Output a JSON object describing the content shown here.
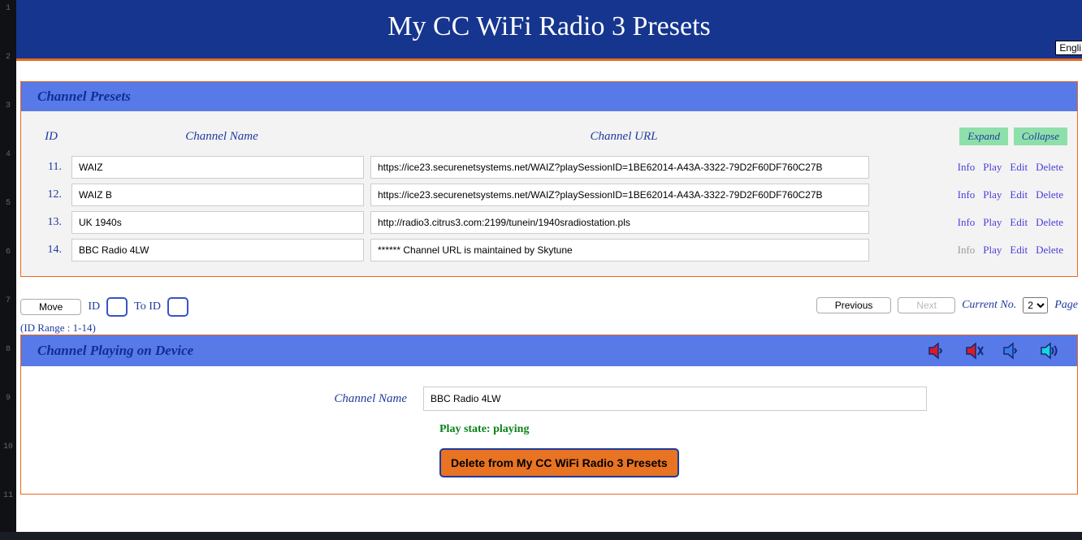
{
  "lineNumbers": [
    "1",
    "2",
    "3",
    "4",
    "5",
    "6",
    "7",
    "8",
    "9",
    "10",
    "11"
  ],
  "header": {
    "title": "My CC WiFi Radio 3 Presets",
    "lang": "Engli"
  },
  "presetsPanel": {
    "title": "Channel Presets",
    "columns": {
      "id": "ID",
      "name": "Channel Name",
      "url": "Channel URL"
    },
    "expand": "Expand",
    "collapse": "Collapse",
    "rows": [
      {
        "id": "11.",
        "name": "WAIZ",
        "url": "https://ice23.securenetsystems.net/WAIZ?playSessionID=1BE62014-A43A-3322-79D2F60DF760C27B",
        "infoDisabled": false
      },
      {
        "id": "12.",
        "name": "WAIZ B",
        "url": "https://ice23.securenetsystems.net/WAIZ?playSessionID=1BE62014-A43A-3322-79D2F60DF760C27B",
        "infoDisabled": false
      },
      {
        "id": "13.",
        "name": "UK 1940s",
        "url": "http://radio3.citrus3.com:2199/tunein/1940sradiostation.pls",
        "infoDisabled": false
      },
      {
        "id": "14.",
        "name": "BBC Radio 4LW",
        "url": "****** Channel URL is maintained by Skytune",
        "infoDisabled": true
      }
    ],
    "actions": {
      "info": "Info",
      "play": "Play",
      "edit": "Edit",
      "delete": "Delete"
    }
  },
  "controls": {
    "move": "Move",
    "idLabel": "ID",
    "toIdLabel": "To ID",
    "range": "(ID Range : 1-14)",
    "previous": "Previous",
    "next": "Next",
    "currentNo": "Current No.",
    "pageValue": "2",
    "pageLabel": "Page"
  },
  "playingPanel": {
    "title": "Channel Playing on Device",
    "nameLabel": "Channel Name",
    "nameValue": "BBC Radio 4LW",
    "playState": "Play state: playing",
    "deleteLabel": "Delete from My CC WiFi Radio 3 Presets"
  }
}
